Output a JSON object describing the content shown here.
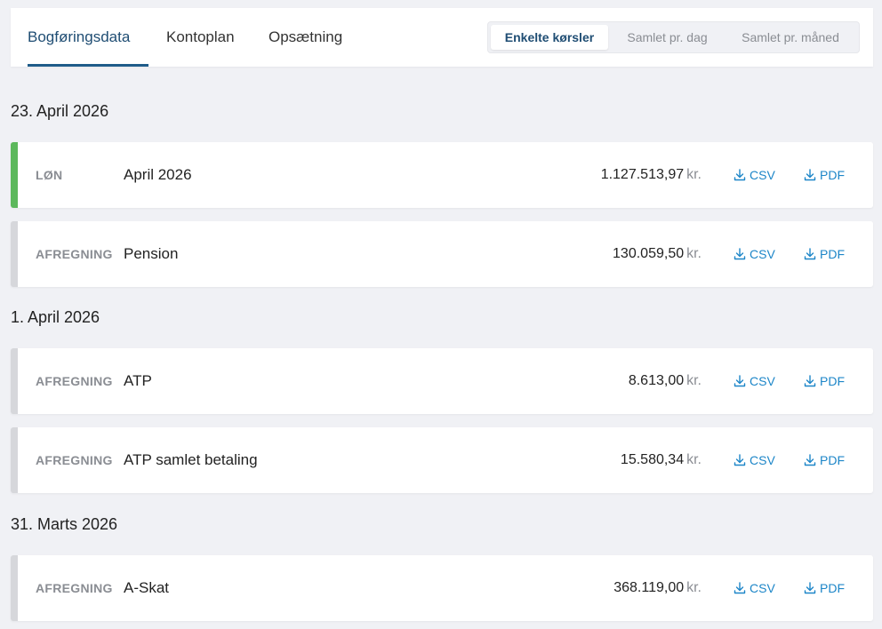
{
  "tabs": [
    {
      "label": "Bogføringsdata",
      "active": true
    },
    {
      "label": "Kontoplan",
      "active": false
    },
    {
      "label": "Opsætning",
      "active": false
    }
  ],
  "view_modes": [
    {
      "label": "Enkelte kørsler",
      "active": true
    },
    {
      "label": "Samlet pr. dag",
      "active": false
    },
    {
      "label": "Samlet pr. måned",
      "active": false
    }
  ],
  "groups": [
    {
      "date": "23. April 2026",
      "rows": [
        {
          "type": "LØN",
          "name": "April 2026",
          "amount": "1.127.513,97",
          "currency": "kr.",
          "csv": "CSV",
          "pdf": "PDF"
        },
        {
          "type": "AFREGNING",
          "name": "Pension",
          "amount": "130.059,50",
          "currency": "kr.",
          "csv": "CSV",
          "pdf": "PDF"
        }
      ]
    },
    {
      "date": "1. April 2026",
      "rows": [
        {
          "type": "AFREGNING",
          "name": "ATP",
          "amount": "8.613,00",
          "currency": "kr.",
          "csv": "CSV",
          "pdf": "PDF"
        },
        {
          "type": "AFREGNING",
          "name": "ATP samlet betaling",
          "amount": "15.580,34",
          "currency": "kr.",
          "csv": "CSV",
          "pdf": "PDF"
        }
      ]
    },
    {
      "date": "31. Marts 2026",
      "rows": [
        {
          "type": "AFREGNING",
          "name": "A-Skat",
          "amount": "368.119,00",
          "currency": "kr.",
          "csv": "CSV",
          "pdf": "PDF"
        }
      ]
    }
  ],
  "colors": {
    "accent_salary": "#5cb85c",
    "accent_settlement": "#d6d7db",
    "link": "#1d86c8",
    "tab_active": "#1f4d73"
  },
  "icons": {
    "download": "download-icon"
  }
}
